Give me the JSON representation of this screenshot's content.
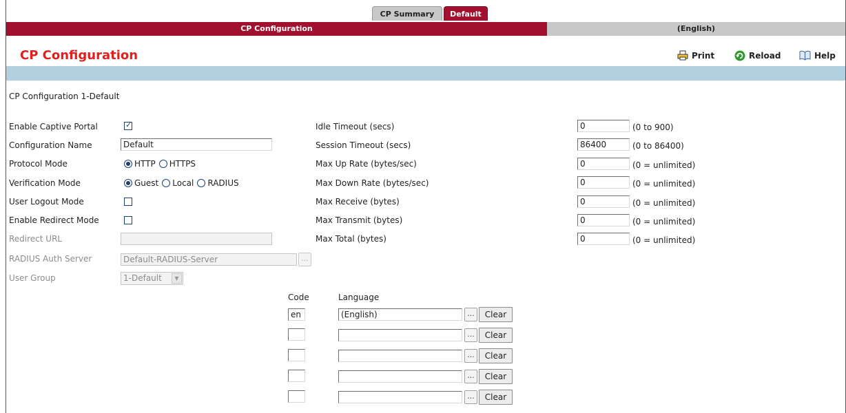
{
  "tabs": [
    {
      "label": "CP Summary",
      "active": false
    },
    {
      "label": "Default",
      "active": true
    }
  ],
  "header_bar": {
    "left": "CP Configuration",
    "right": "(English)"
  },
  "page_title": "CP Configuration",
  "toolbar": {
    "print": "Print",
    "reload": "Reload",
    "help": "Help"
  },
  "section_label": "CP Configuration 1-Default",
  "left_form": {
    "enable_captive_portal": {
      "label": "Enable Captive Portal",
      "checked": true
    },
    "configuration_name": {
      "label": "Configuration Name",
      "value": "Default"
    },
    "protocol_mode": {
      "label": "Protocol Mode",
      "options": [
        "HTTP",
        "HTTPS"
      ],
      "selected": "HTTP"
    },
    "verification_mode": {
      "label": "Verification Mode",
      "options": [
        "Guest",
        "Local",
        "RADIUS"
      ],
      "selected": "Guest"
    },
    "user_logout_mode": {
      "label": "User Logout Mode",
      "checked": false
    },
    "enable_redirect_mode": {
      "label": "Enable Redirect Mode",
      "checked": false
    },
    "redirect_url": {
      "label": "Redirect URL",
      "value": ""
    },
    "radius_auth_server": {
      "label": "RADIUS Auth Server",
      "value": "Default-RADIUS-Server",
      "button": "..."
    },
    "user_group": {
      "label": "User Group",
      "value": "1-Default"
    }
  },
  "right_form": {
    "idle_timeout": {
      "label": "Idle Timeout (secs)",
      "value": "0",
      "hint": "(0 to 900)"
    },
    "session_timeout": {
      "label": "Session Timeout (secs)",
      "value": "86400",
      "hint": "(0 to 86400)"
    },
    "max_up_rate": {
      "label": "Max Up Rate (bytes/sec)",
      "value": "0",
      "hint": "(0 = unlimited)"
    },
    "max_down_rate": {
      "label": "Max Down Rate (bytes/sec)",
      "value": "0",
      "hint": "(0 = unlimited)"
    },
    "max_receive": {
      "label": "Max Receive (bytes)",
      "value": "0",
      "hint": "(0 = unlimited)"
    },
    "max_transmit": {
      "label": "Max Transmit (bytes)",
      "value": "0",
      "hint": "(0 = unlimited)"
    },
    "max_total": {
      "label": "Max Total (bytes)",
      "value": "0",
      "hint": "(0 = unlimited)"
    }
  },
  "locales": {
    "code_header": "Code",
    "language_header": "Language",
    "browse_label": "...",
    "clear_label": "Clear",
    "rows": [
      {
        "code": "en",
        "language": "(English)"
      },
      {
        "code": "",
        "language": ""
      },
      {
        "code": "",
        "language": ""
      },
      {
        "code": "",
        "language": ""
      },
      {
        "code": "",
        "language": ""
      }
    ]
  },
  "colors": {
    "accent": "#a1102e",
    "title": "#e0201e",
    "band": "#b3d0e0",
    "tab_inactive": "#c8c8c8"
  }
}
